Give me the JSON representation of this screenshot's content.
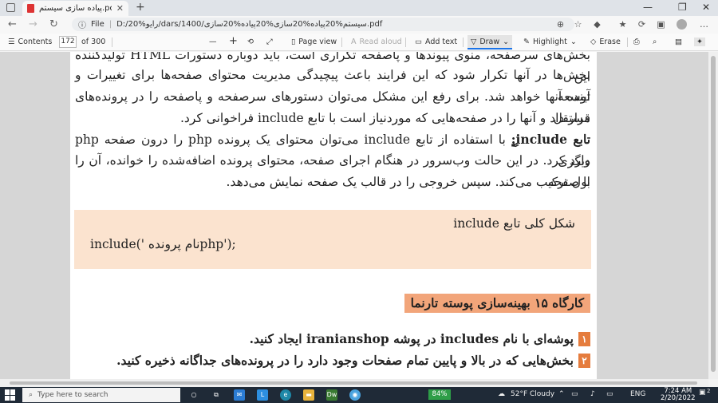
{
  "browser": {
    "tab_title": "پیاده سازی سیستم.pdf",
    "tab_close": "✕",
    "new_tab": "+",
    "window_controls": [
      "—",
      "❐",
      "✕"
    ],
    "url_prefix": "File",
    "url": "D:/20%رایو/dars/1400/سیستم%20پیاده%20سازی%20پیاده%20سازی.pdf"
  },
  "pdf_toolbar": {
    "contents": "Contents",
    "page_current": "172",
    "page_total": "of 300",
    "zoom_out": "—",
    "zoom_in": "+",
    "page_view": "Page view",
    "read_aloud": "Read aloud",
    "add_text": "Add text",
    "draw": "Draw",
    "highlight": "Highlight",
    "erase": "Erase"
  },
  "document": {
    "line1": "بخش‌های سرصفحه، منوی پیوندها و پاصفحه تکراری است، باید دوباره دستورات HTML تولیدکننده این",
    "line2": "بخش‌ها در آنها تکرار شود که این فرایند باعث پیچیدگی مدیریت محتوای صفحه‌ها برای تغییرات و توسعه",
    "line3": "آینده آنها خواهد شد. برای رفع این مشکل می‌توان دستورهای سرصفحه و پاصفحه را در پرونده‌های مستقل",
    "line4": "قرار داد و آنها را در صفحه‌هایی که موردنیاز است با تابع include فراخوانی کرد.",
    "include_title": "تابع include:",
    "line5_rest": " با استفاده از تابع include می‌توان محتوای یک پرونده php را درون صفحه php دیگری",
    "line6": "وارد کرد. در این حالت وب‌سرور در هنگام اجرای صفحه، محتوای پرونده اضافه‌شده را خوانده، آن را با صفحه",
    "line7": "اول ترکیب می‌کند. سپس خروجی را در قالب یک صفحه نمایش می‌دهد.",
    "code_caption": "شکل کلی تابع include",
    "code_line": "include(' نام پرونده‌php');",
    "workshop_title": "کارگاه ۱۵  بهینه‌سازی پوسته تارنما",
    "step1_num": "۱",
    "step1": "پوشه‌ای با نام includes در پوشه iranianshop ایجاد کنید.",
    "step2_num": "۲",
    "step2": "بخش‌هایی که در بالا و پایین تمام صفحات وجود دارد را در پرونده‌های جداگانه ذخیره کنید."
  },
  "taskbar": {
    "search_placeholder": "Type here to search",
    "battery": "84%",
    "weather": "52°F  Cloudy",
    "language": "ENG",
    "time": "7:24 AM",
    "date": "2/20/2022",
    "notifications": "2"
  }
}
